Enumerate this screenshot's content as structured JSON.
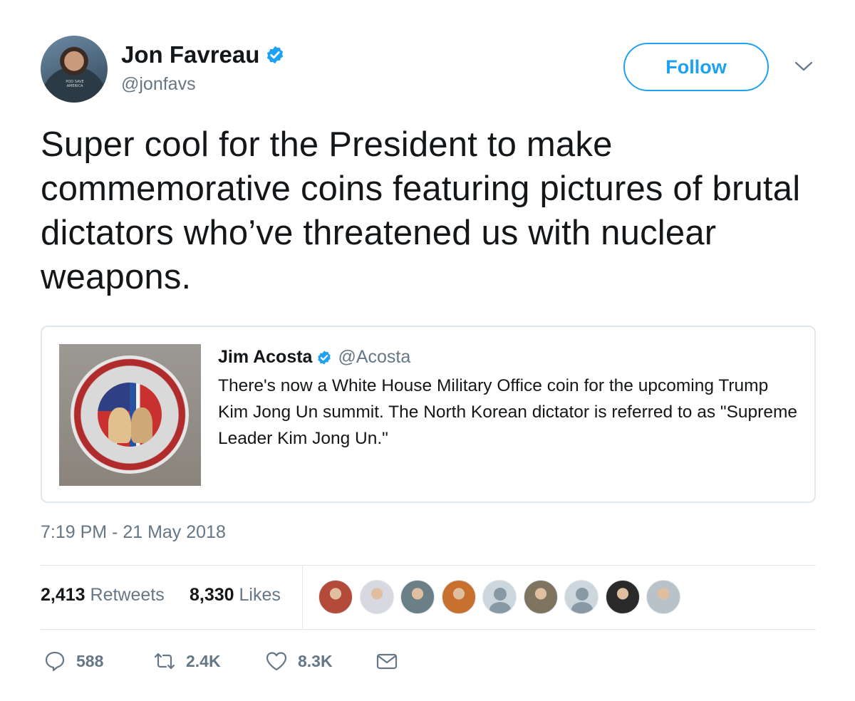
{
  "author": {
    "name": "Jon Favreau",
    "handle": "@jonfavs",
    "avatar_shirt_text": "POD SAVE AMERICA",
    "verified_icon": "verified-badge-icon"
  },
  "follow_button": {
    "label": "Follow"
  },
  "more_menu_icon": "chevron-down-icon",
  "tweet": {
    "text": "Super cool for the President to make commemorative coins featuring pictures of brutal dictators who’ve threatened us with nuclear weapons."
  },
  "quoted_tweet": {
    "author_name": "Jim Acosta",
    "author_handle": "@Acosta",
    "text": "There's now a White House Military Office coin for the upcoming Trump Kim Jong Un summit. The North Korean dictator is referred to as \"Supreme Leader Kim Jong Un.\"",
    "image_description_icon": "coin-photo"
  },
  "timestamp": "7:19 PM - 21 May 2018",
  "stats": {
    "retweets_count": "2,413",
    "retweets_label": "Retweets",
    "likes_count": "8,330",
    "likes_label": "Likes"
  },
  "liked_by_avatars": [
    {
      "kind": "photo",
      "color": "#b34a3a"
    },
    {
      "kind": "photo",
      "color": "#d8d8e0"
    },
    {
      "kind": "photo",
      "color": "#6a7f86"
    },
    {
      "kind": "photo",
      "color": "#c8702e"
    },
    {
      "kind": "default",
      "color": "#ccd6dd"
    },
    {
      "kind": "photo",
      "color": "#7e7460"
    },
    {
      "kind": "default",
      "color": "#ccd6dd"
    },
    {
      "kind": "photo",
      "color": "#2a2a2a"
    },
    {
      "kind": "photo",
      "color": "#b9c2c8"
    }
  ],
  "actions": {
    "reply_count": "588",
    "retweet_count": "2.4K",
    "like_count": "8.3K"
  },
  "colors": {
    "accent": "#1da1f2",
    "secondary_text": "#657786",
    "primary_text": "#14171a",
    "border": "#e1e8ed"
  }
}
